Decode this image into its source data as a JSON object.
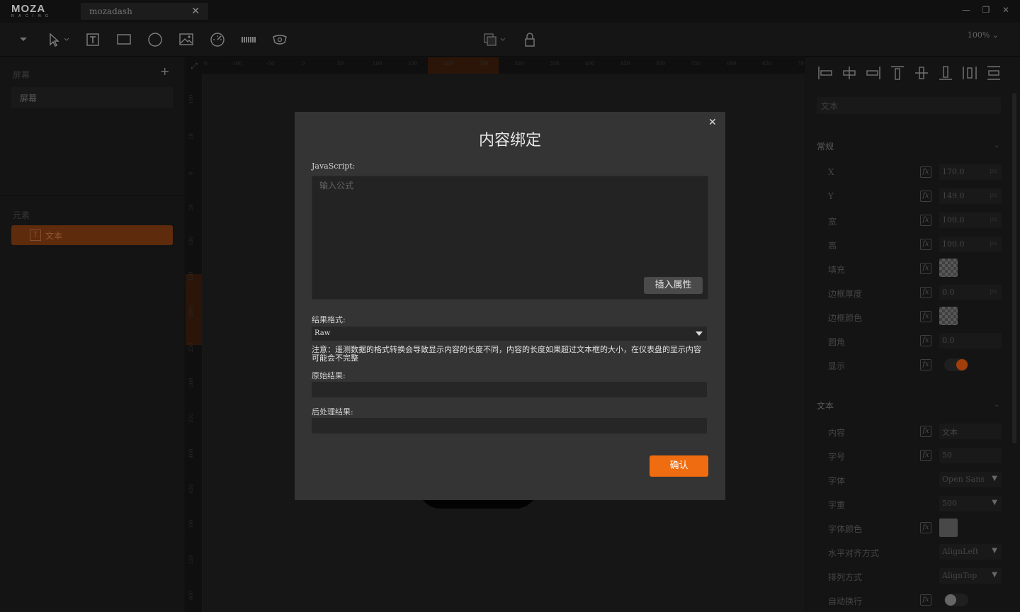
{
  "app": {
    "logo_text": "MOZA",
    "logo_subtext": "RACING",
    "tab_title": "mozadash"
  },
  "toolbar": {
    "zoom": "100%"
  },
  "left_panel": {
    "screens_title": "屏幕",
    "screen_item": "屏幕",
    "elements_title": "元素",
    "element_item": "文本"
  },
  "rulers": {
    "top_ticks": [
      "0",
      "-100",
      "-50",
      "0",
      "50",
      "100",
      "150",
      "200",
      "250",
      "300",
      "350",
      "400",
      "450",
      "500",
      "550",
      "600",
      "650",
      "70"
    ],
    "left_ticks": [
      "100",
      "50",
      "0",
      "50",
      "100",
      "150",
      "200",
      "250",
      "300",
      "350",
      "400",
      "450",
      "500",
      "550",
      "600"
    ]
  },
  "right_panel": {
    "name_value": "文本",
    "general_title": "常规",
    "props": [
      {
        "label": "X",
        "value": "170.0",
        "unit": "px"
      },
      {
        "label": "Y",
        "value": "149.0",
        "unit": "px"
      },
      {
        "label": "宽",
        "value": "100.0",
        "unit": "px"
      },
      {
        "label": "高",
        "value": "100.0",
        "unit": "px"
      },
      {
        "label": "填充"
      },
      {
        "label": "边框厚度",
        "value": "0.0",
        "unit": "px"
      },
      {
        "label": "边框颜色"
      },
      {
        "label": "圆角",
        "value": "0.0"
      },
      {
        "label": "显示"
      }
    ],
    "text_title": "文本",
    "text_props": [
      {
        "label": "内容",
        "value": "文本"
      },
      {
        "label": "字号",
        "value": "50"
      },
      {
        "label": "字体",
        "value": "Open Sans"
      },
      {
        "label": "字重",
        "value": "500"
      },
      {
        "label": "字体颜色"
      },
      {
        "label": "水平对齐方式",
        "value": "AlignLeft"
      },
      {
        "label": "排列方式",
        "value": "AlignTop"
      },
      {
        "label": "自动换行"
      }
    ],
    "show_toggle_color": "#d9530d"
  },
  "dialog": {
    "title": "内容绑定",
    "js_label": "JavaScript:",
    "js_placeholder": "输入公式",
    "insert_button": "插入属性",
    "format_label": "结果格式:",
    "format_value": "Raw",
    "note": "注意：遥测数据的格式转换会导致显示内容的长度不同，内容的长度如果超过文本框的大小，在仪表盘的显示内容可能会不完整",
    "raw_result_label": "原始结果:",
    "post_result_label": "后处理结果:",
    "confirm_button": "确认",
    "accent_color": "#ef6c10"
  }
}
